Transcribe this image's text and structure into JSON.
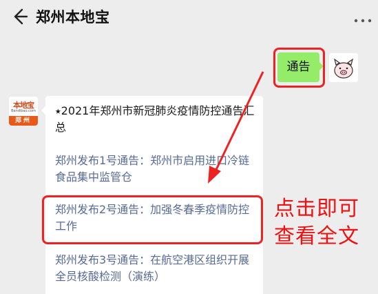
{
  "header": {
    "back_icon": "back-arrow-icon",
    "title": "郑州本地宝",
    "more_icon": "more-dots-icon"
  },
  "user_message": {
    "text": "通告",
    "bubble_color": "#95ec69",
    "avatar_icon": "pig-avatar-icon"
  },
  "bot_message": {
    "avatar": {
      "brand": "本地宝",
      "site": "Bendibao.com",
      "city": "郑州"
    },
    "heading": "⭑2021年郑州市新冠肺炎疫情防控通告汇总",
    "links": [
      {
        "text": "郑州发布1号通告：郑州市启用进口冷链食品集中监管仓"
      },
      {
        "text": "郑州发布2号通告：加强冬春季疫情防控工作"
      },
      {
        "text": "郑州发布3号通告：在航空港区组织开展全员核酸检测（演练）"
      }
    ],
    "link_color": "#576b95"
  },
  "annotation": {
    "line1": "点击即可",
    "line2": "查看全文",
    "color": "#ee1111"
  }
}
